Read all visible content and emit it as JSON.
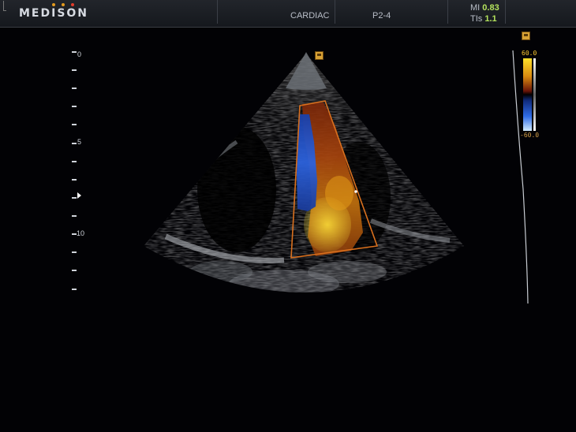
{
  "header": {
    "brand": "MEDISON",
    "brand_dot_colors": [
      "#e39a1e",
      "#e39a1e",
      "#e23c2b"
    ],
    "application": "CARDIAC",
    "probe": "P2-4",
    "mi_label": "MI",
    "mi_value": "0.83",
    "tis_label": "TIs",
    "tis_value": "1.1"
  },
  "depth_scale": {
    "labels": [
      "0",
      "5",
      "10"
    ],
    "focus_marker_icon": "focus-triangle-icon"
  },
  "color_map": {
    "max_label": "60.0",
    "min_label": "-60.0",
    "colors": {
      "positive": "#ffd21a",
      "negative": "#2d62e0",
      "roi_outline": "#d9701e",
      "accent": "#b4e35d"
    }
  },
  "icons": {
    "probe_orientation": "orientation-marker-icon",
    "colormap_indicator": "square-marker-icon"
  }
}
